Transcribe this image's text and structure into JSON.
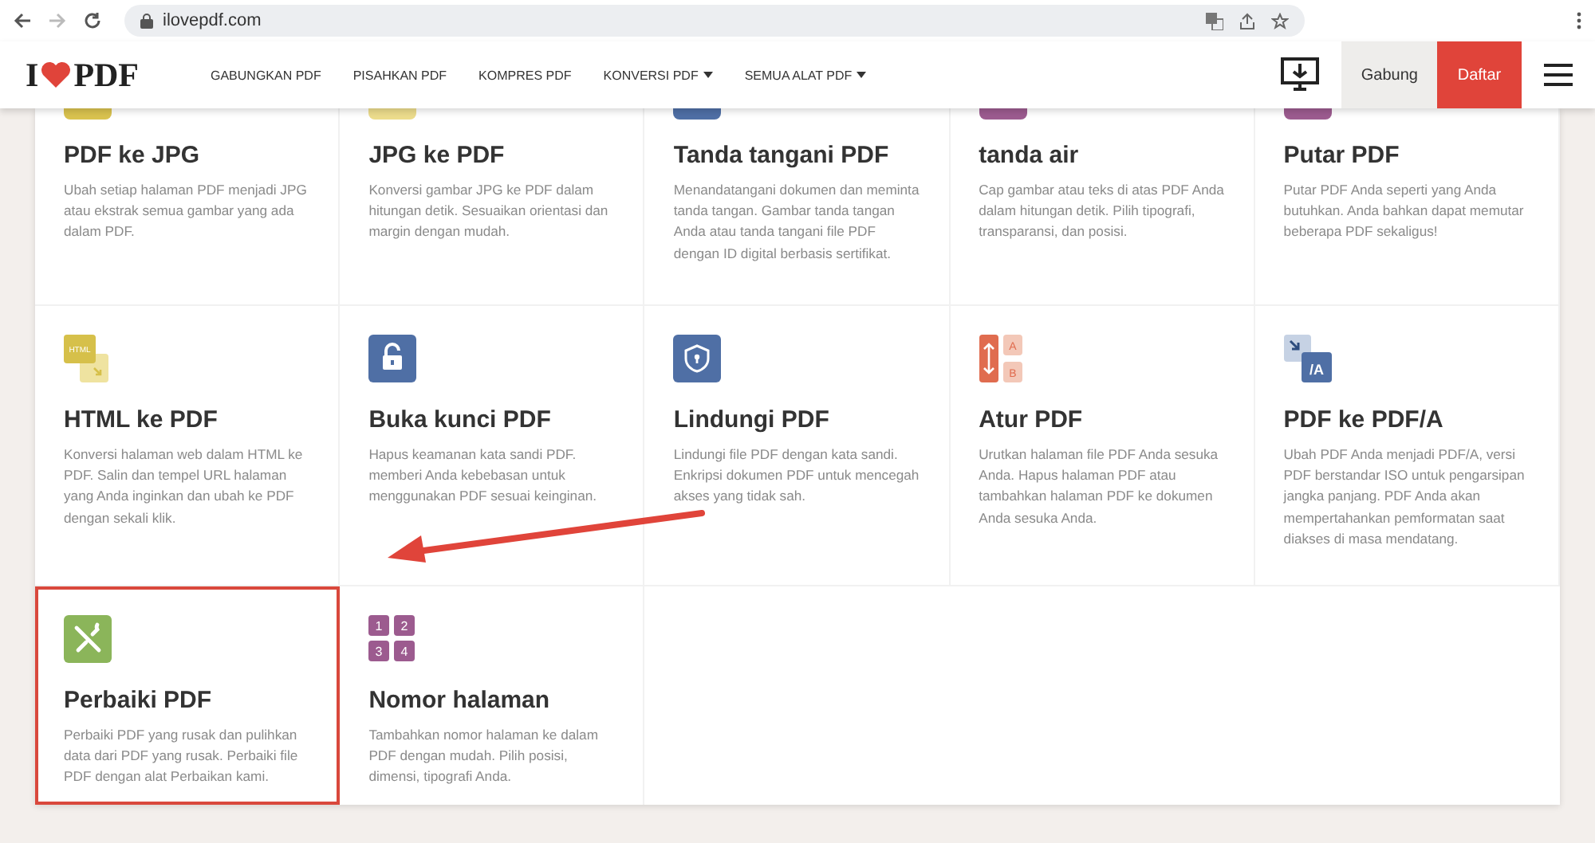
{
  "browser": {
    "url": "ilovepdf.com"
  },
  "header": {
    "logo": [
      "I",
      "PDF"
    ],
    "nav": [
      {
        "label": "GABUNGKAN PDF",
        "dropdown": false
      },
      {
        "label": "PISAHKAN PDF",
        "dropdown": false
      },
      {
        "label": "KOMPRES PDF",
        "dropdown": false
      },
      {
        "label": "KONVERSI PDF",
        "dropdown": true
      },
      {
        "label": "SEMUA ALAT PDF",
        "dropdown": true
      }
    ],
    "login": "Gabung",
    "signup": "Daftar"
  },
  "rows": [
    {
      "tools": [
        {
          "title": "PDF ke JPG",
          "description": "Ubah setiap halaman PDF menjadi JPG atau ekstrak semua gambar yang ada dalam PDF.",
          "kind": "plain",
          "color": "#d9c24f",
          "highlighted": false
        },
        {
          "title": "JPG ke PDF",
          "description": "Konversi gambar JPG ke PDF dalam hitungan detik. Sesuaikan orientasi dan margin dengan mudah.",
          "kind": "plain",
          "color": "#ecdc8c",
          "highlighted": false
        },
        {
          "title": "Tanda tangani PDF",
          "description": "Menandatangani dokumen dan meminta tanda tangan. Gambar tanda tangan Anda atau tanda tangani file PDF dengan ID digital berbasis sertifikat.",
          "kind": "plain",
          "color": "#4f6fa5",
          "highlighted": false
        },
        {
          "title": "tanda air",
          "description": "Cap gambar atau teks di atas PDF Anda dalam hitungan detik. Pilih tipografi, transparansi, dan posisi.",
          "kind": "plain",
          "color": "#9c5b8f",
          "highlighted": false
        },
        {
          "title": "Putar PDF",
          "description": "Putar PDF Anda seperti yang Anda butuhkan. Anda bahkan dapat memutar beberapa PDF sekaligus!",
          "kind": "plain",
          "color": "#9c5b8f",
          "highlighted": false
        }
      ]
    },
    {
      "tools": [
        {
          "title": "HTML ke PDF",
          "description": "Konversi halaman web dalam HTML ke PDF. Salin dan tempel URL halaman yang Anda inginkan dan ubah ke PDF dengan sekali klik.",
          "kind": "html",
          "icon_text": [
            "HTML"
          ],
          "color": "#d6c04a",
          "highlighted": false
        },
        {
          "title": "Buka kunci PDF",
          "description": "Hapus keamanan kata sandi PDF. memberi Anda kebebasan untuk menggunakan PDF sesuai keinginan.",
          "kind": "unlock",
          "color": "#4f6fa5",
          "highlighted": false
        },
        {
          "title": "Lindungi PDF",
          "description": "Lindungi file PDF dengan kata sandi. Enkripsi dokumen PDF untuk mencegah akses yang tidak sah.",
          "kind": "shield",
          "color": "#4f6fa5",
          "highlighted": false
        },
        {
          "title": "Atur PDF",
          "description": "Urutkan halaman file PDF Anda sesuka Anda. Hapus halaman PDF atau tambahkan halaman PDF ke dokumen Anda sesuka Anda.",
          "kind": "organize",
          "icon_text": [
            "A",
            "B"
          ],
          "color": "#e06c4f",
          "highlighted": false
        },
        {
          "title": "PDF ke PDF/A",
          "description": "Ubah PDF Anda menjadi PDF/A, versi PDF berstandar ISO untuk pengarsipan jangka panjang. PDF Anda akan mempertahankan pemformatan saat diakses di masa mendatang.",
          "kind": "pdfa",
          "icon_text": [
            "/A"
          ],
          "color": "#4f6fa5",
          "highlighted": false
        }
      ]
    },
    {
      "tools": [
        {
          "title": "Perbaiki PDF",
          "description": "Perbaiki PDF yang rusak dan pulihkan data dari PDF yang rusak. Perbaiki file PDF dengan alat Perbaikan kami.",
          "kind": "tools",
          "color": "#8bb55a",
          "highlighted": true
        },
        {
          "title": "Nomor halaman",
          "description": "Tambahkan nomor halaman ke dalam PDF dengan mudah. Pilih posisi, dimensi, tipografi Anda.",
          "kind": "numbers",
          "icon_text": [
            "1",
            "2",
            "3",
            "4"
          ],
          "color": "#9c5b8f",
          "highlighted": false
        }
      ]
    }
  ]
}
